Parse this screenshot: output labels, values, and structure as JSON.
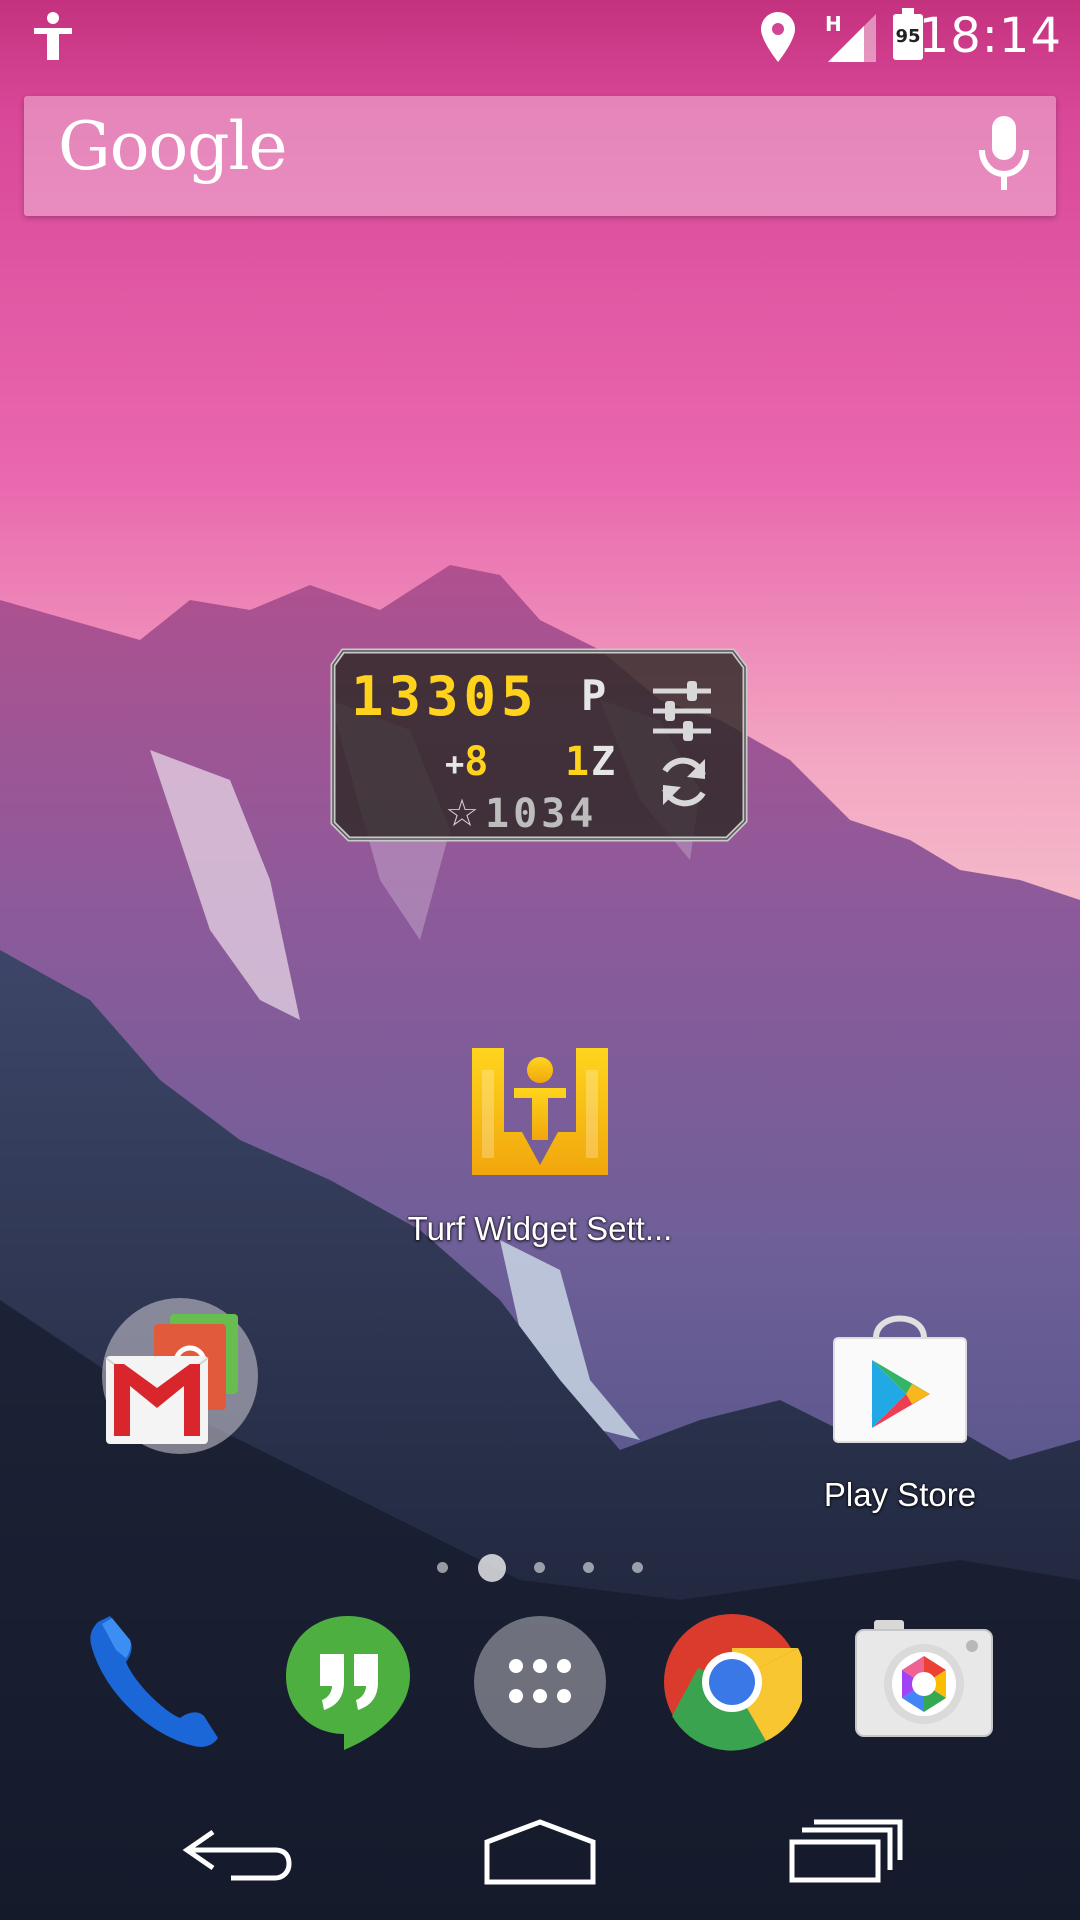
{
  "status_bar": {
    "time": "18:14",
    "battery_level": "95",
    "network_type": "H",
    "icons": [
      "accessibility-icon",
      "location-icon",
      "signal-icon",
      "battery-icon"
    ]
  },
  "search_widget": {
    "logo_text": "Google",
    "icons": [
      "mic-icon"
    ]
  },
  "turf_widget": {
    "points": "13305",
    "points_unit": "P",
    "points_delta_sign": "+",
    "points_delta": "8",
    "zones": "1",
    "zones_unit": "Z",
    "rank_symbol": "☆",
    "rank": "1034",
    "colors": {
      "value": "#ffd21c",
      "unit": "#e6e6e6"
    },
    "icons": [
      "settings-sliders-icon",
      "refresh-icon"
    ]
  },
  "home_apps": [
    {
      "label": "Turf Widget Sett...",
      "icon": "turf-widget-icon"
    },
    {
      "label": "",
      "icon": "google-folder-icon"
    },
    {
      "label": "Play Store",
      "icon": "play-store-icon"
    }
  ],
  "page_indicator": {
    "pages": 5,
    "current": 2
  },
  "dock": [
    {
      "icon": "phone-icon"
    },
    {
      "icon": "hangouts-icon"
    },
    {
      "icon": "app-drawer-icon"
    },
    {
      "icon": "chrome-icon"
    },
    {
      "icon": "camera-icon"
    }
  ],
  "nav_bar": {
    "icons": [
      "back-icon",
      "home-icon",
      "recents-icon"
    ]
  }
}
